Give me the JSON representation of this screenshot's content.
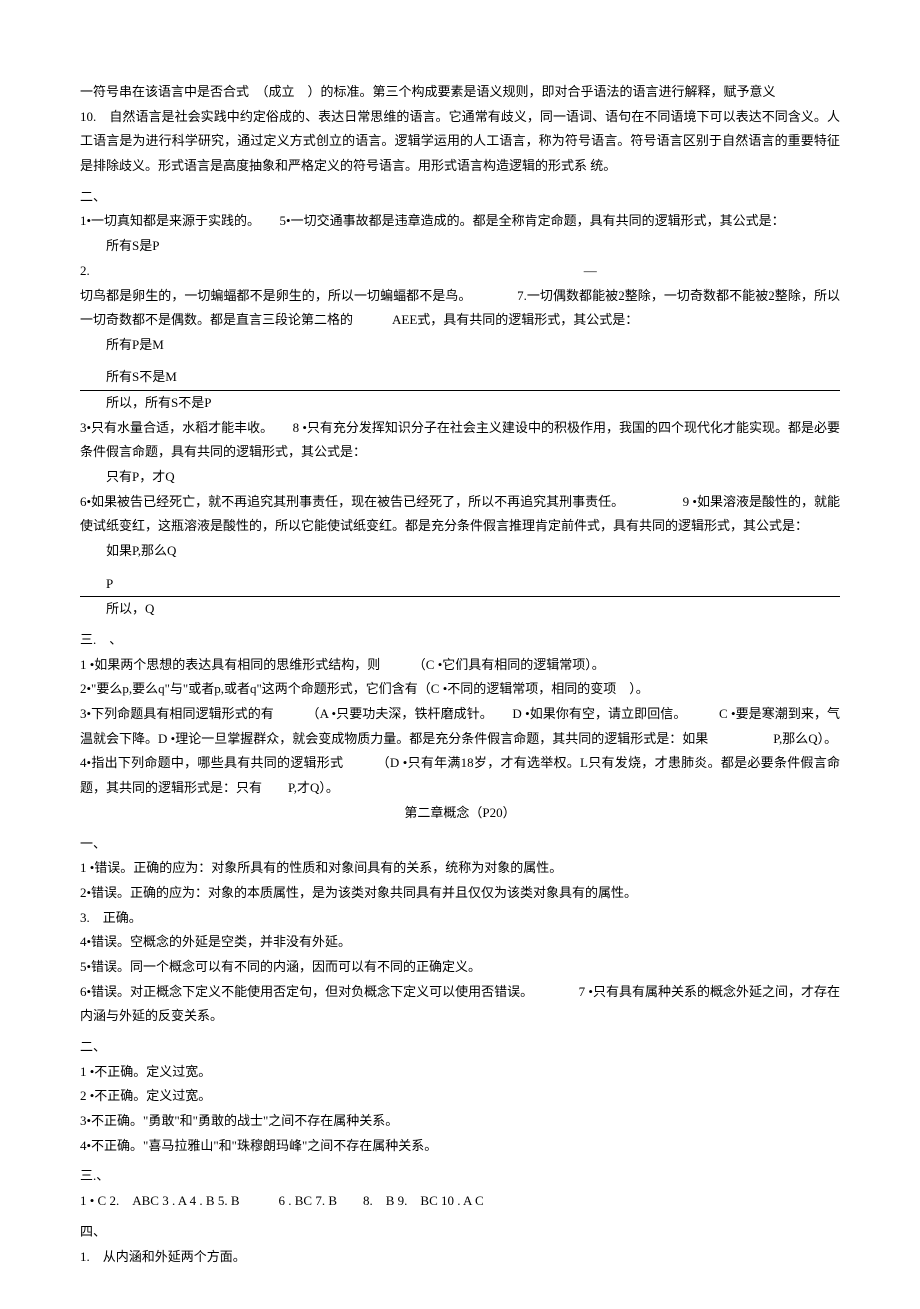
{
  "p1": "一符号串在该语言中是否合式　（成立　）的标准。第三个构成要素是语义规则，即对合乎语法的语言进行解释，赋予意义",
  "p2": "10.　自然语言是社会实践中约定俗成的、表达日常思维的语言。它通常有歧义，同一语词、语句在不同语境下可以表达不同含义。人工语言是为进行科学研究，通过定义方式创立的语言。逻辑学运用的人工语言，称为符号语言。符号语言区别于自然语言的重要特征是排除歧义。形式语言是高度抽象和严格定义的符号语言。用形式语言构造逻辑的形式系 统。",
  "sec2_hdr": "二、",
  "q2_1": "1•一切真知都是来源于实践的。　　5•一切交通事故都是违章造成的。都是全称肯定命题，具有共同的逻辑形式，其公式是：",
  "q2_1f": "所有S是P",
  "q2_2a": "2.　　　　　　　　　　　　　　　　　　　　　　　　　　　　　　　　　　　　　　—",
  "q2_2b": "切鸟都是卵生的，一切蝙蝠都不是卵生的，所以一切蝙蝠都不是鸟。　　　　7.一切偶数都能被2整除，一切奇数都不能被2整除，所以一切奇数都不是偶数。都是直言三段论第二格的　　　AEE式，具有共同的逻辑形式，其公式是：",
  "q2_2f1": "所有P是M",
  "q2_2f2": "所有S不是M",
  "q2_2f3": "所以，所有S不是P",
  "q2_3": "3•只有水量合适，水稻才能丰收。　　8 •只有充分发挥知识分子在社会主义建设中的积极作用，我国的四个现代化才能实现。都是必要条件假言命题，具有共同的逻辑形式，其公式是：",
  "q2_3f": "只有P，才Q",
  "q2_6": "6•如果被告已经死亡，就不再追究其刑事责任，现在被告已经死了，所以不再追究其刑事责任。　　　　　9 •如果溶液是酸性的，就能使试纸变红，这瓶溶液是酸性的，所以它能使试纸变红。都是充分条件假言推理肯定前件式，具有共同的逻辑形式，其公式是：",
  "q2_6f1": "如果P,那么Q",
  "q2_6f2": "P",
  "q2_6f3": "所以，Q",
  "sec3_hdr": "三.　、",
  "q3_1": "1 •如果两个思想的表达具有相同的思维形式结构，则　　　（C •它们具有相同的逻辑常项）。",
  "q3_2": "2•\"要么p,要么q\"与\"或者p,或者q\"这两个命题形式，它们含有（C •不同的逻辑常项，相同的变项　）。",
  "q3_3": "3•下列命题具有相同逻辑形式的有　　　（A •只要功夫深，铁杆磨成针。　　D •如果你有空，请立即回信。　　　C •要是寒潮到来，气温就会下降。D •理论一旦掌握群众，就会变成物质力量。都是充分条件假言命题，其共同的逻辑形式是：如果　　　　　P,那么Q）。",
  "q3_4": "4•指出下列命题中，哪些具有共同的逻辑形式　　　（D •只有年满18岁，才有选举权。L只有发烧，才患肺炎。都是必要条件假言命题，其共同的逻辑形式是：只有　　P,才Q）。",
  "chapter2_title": "第二章概念（P20）",
  "sec_c2_1_hdr": "一、",
  "c2_1_1": "1 •错误。正确的应为：对象所具有的性质和对象间具有的关系，统称为对象的属性。",
  "c2_1_2": "2•错误。正确的应为：对象的本质属性，是为该类对象共同具有并且仅仅为该类对象具有的属性。",
  "c2_1_3": "3.　正确。",
  "c2_1_4": "4•错误。空概念的外延是空类，并非没有外延。",
  "c2_1_5": "5•错误。同一个概念可以有不同的内涵，因而可以有不同的正确定义。",
  "c2_1_6": "6•错误。对正概念下定义不能使用否定句，但对负概念下定义可以使用否错误。　　　　7 •只有具有属种关系的概念外延之间，才存在内涵与外延的反变关系。",
  "sec_c2_2_hdr": "二、",
  "c2_2_1": "1 •不正确。定义过宽。",
  "c2_2_2": "2 •不正确。定义过宽。",
  "c2_2_3": "3•不正确。\"勇敢\"和\"勇敢的战士\"之间不存在属种关系。",
  "c2_2_4": "4•不正确。\"喜马拉雅山\"和\"珠穆朗玛峰\"之间不存在属种关系。",
  "sec_c2_3_hdr": "三.、",
  "c2_3_ans": "1 • C 2.　ABC 3 . A 4 . B 5. B　　　6 . BC 7. B　　8.　B 9.　BC 10 . A C",
  "sec_c2_4_hdr": "四、",
  "c2_4_1": "1.　从内涵和外延两个方面。"
}
